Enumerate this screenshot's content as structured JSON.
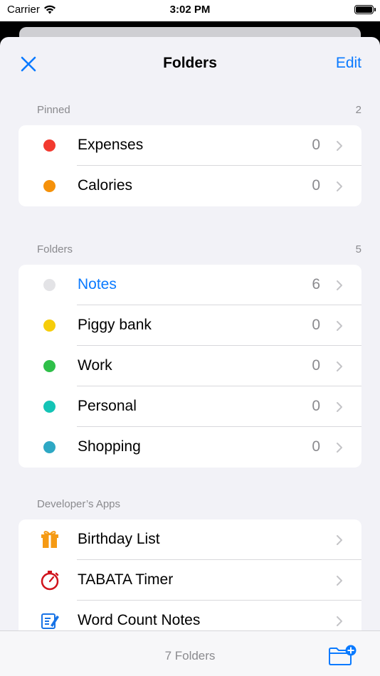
{
  "status_bar": {
    "carrier": "Carrier",
    "time": "3:02 PM"
  },
  "nav": {
    "title": "Folders",
    "edit_label": "Edit",
    "close_icon": "close-icon"
  },
  "pinned": {
    "header": "Pinned",
    "count": "2",
    "items": [
      {
        "label": "Expenses",
        "count": "0",
        "color": "#f23a2f"
      },
      {
        "label": "Calories",
        "count": "0",
        "color": "#f5910a"
      }
    ]
  },
  "folders": {
    "header": "Folders",
    "count": "5",
    "items": [
      {
        "label": "Notes",
        "count": "6",
        "color": "#e3e3e6",
        "selected": true
      },
      {
        "label": "Piggy bank",
        "count": "0",
        "color": "#f6cd0a"
      },
      {
        "label": "Work",
        "count": "0",
        "color": "#2fbf49"
      },
      {
        "label": "Personal",
        "count": "0",
        "color": "#14c4b6"
      },
      {
        "label": "Shopping",
        "count": "0",
        "color": "#2ea8c4"
      }
    ]
  },
  "developer_apps": {
    "header": "Developer’s Apps",
    "items": [
      {
        "label": "Birthday List",
        "icon": "gift-icon",
        "color": "#f59a14"
      },
      {
        "label": "TABATA Timer",
        "icon": "stopwatch-icon",
        "color": "#d0121b"
      },
      {
        "label": "Word Count Notes",
        "icon": "notes-pencil-icon",
        "color": "#1773e6"
      }
    ]
  },
  "toolbar": {
    "status": "7 Folders",
    "new_folder_icon": "new-folder-icon"
  },
  "colors": {
    "accent": "#0a7aff",
    "secondary_text": "#8a8a8e",
    "background": "#f2f2f7"
  }
}
